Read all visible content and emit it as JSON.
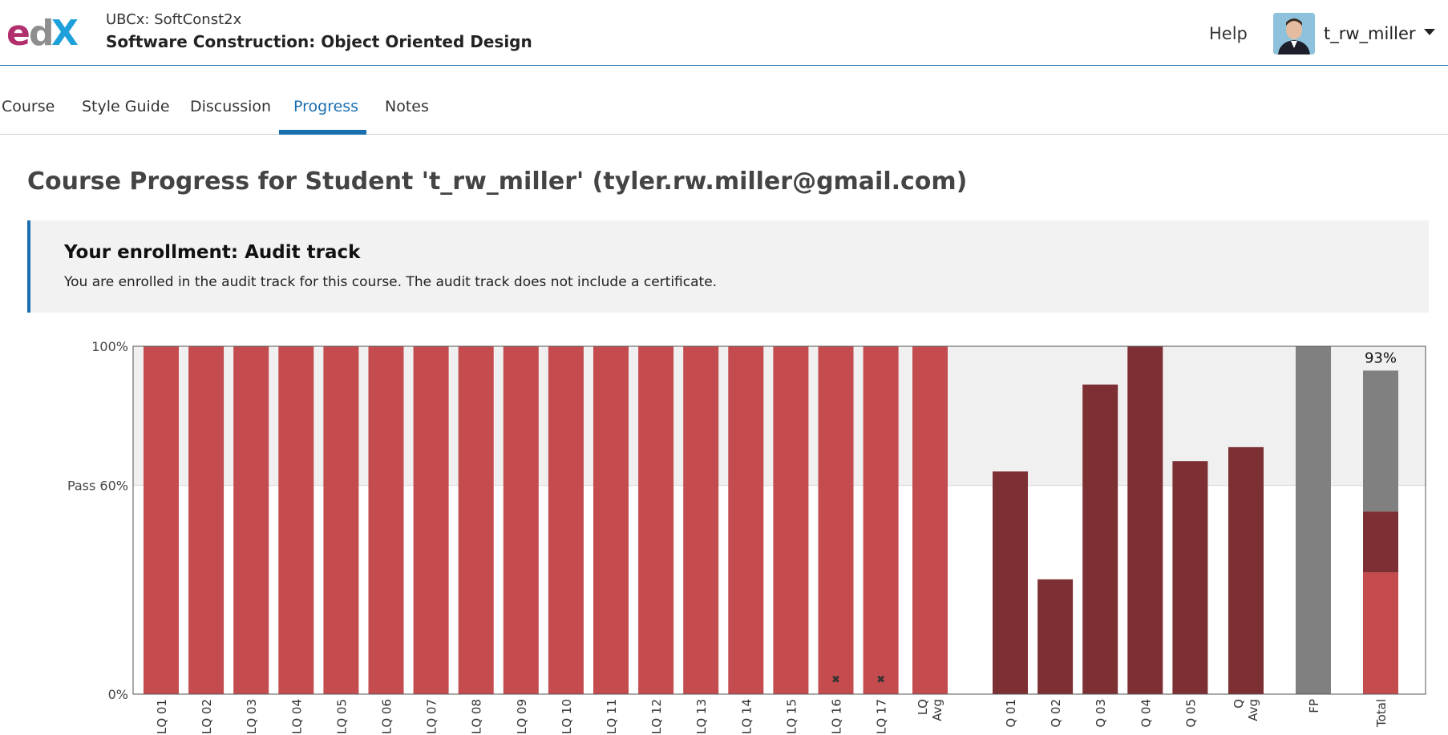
{
  "header": {
    "course_org": "UBCx: SoftConst2x",
    "course_title": "Software Construction: Object Oriented Design",
    "help_label": "Help",
    "username": "t_rw_miller"
  },
  "tabs": [
    {
      "label": "Course",
      "active": false
    },
    {
      "label": "Style Guide",
      "active": false
    },
    {
      "label": "Discussion",
      "active": false
    },
    {
      "label": "Progress",
      "active": true
    },
    {
      "label": "Notes",
      "active": false
    }
  ],
  "page": {
    "title": "Course Progress for Student 't_rw_miller' (tyler.rw.miller@gmail.com)"
  },
  "enrollment": {
    "heading": "Your enrollment: Audit track",
    "text": "You are enrolled in the audit track for this course. The audit track does not include a certificate."
  },
  "colors": {
    "accent": "#1a6fb0",
    "lq_bar": "#c44b4e",
    "quiz_bar": "#7d3034",
    "fp_bar": "#808080",
    "pass_band": "#f0f0f0"
  },
  "chart_data": {
    "type": "bar",
    "ylim": [
      0,
      100
    ],
    "y_ticks": [
      {
        "value": 100,
        "label": "100%"
      },
      {
        "value": 60,
        "label": "Pass 60%"
      },
      {
        "value": 0,
        "label": "0%"
      }
    ],
    "bars": [
      {
        "label": "LQ 01",
        "value": 100,
        "group": "lq"
      },
      {
        "label": "LQ 02",
        "value": 100,
        "group": "lq"
      },
      {
        "label": "LQ 03",
        "value": 100,
        "group": "lq"
      },
      {
        "label": "LQ 04",
        "value": 100,
        "group": "lq"
      },
      {
        "label": "LQ 05",
        "value": 100,
        "group": "lq"
      },
      {
        "label": "LQ 06",
        "value": 100,
        "group": "lq"
      },
      {
        "label": "LQ 07",
        "value": 100,
        "group": "lq"
      },
      {
        "label": "LQ 08",
        "value": 100,
        "group": "lq"
      },
      {
        "label": "LQ 09",
        "value": 100,
        "group": "lq"
      },
      {
        "label": "LQ 10",
        "value": 100,
        "group": "lq"
      },
      {
        "label": "LQ 11",
        "value": 100,
        "group": "lq"
      },
      {
        "label": "LQ 12",
        "value": 100,
        "group": "lq"
      },
      {
        "label": "LQ 13",
        "value": 100,
        "group": "lq"
      },
      {
        "label": "LQ 14",
        "value": 100,
        "group": "lq"
      },
      {
        "label": "LQ 15",
        "value": 100,
        "group": "lq"
      },
      {
        "label": "LQ 16",
        "value": 100,
        "group": "lq",
        "dropped": true
      },
      {
        "label": "LQ 17",
        "value": 100,
        "group": "lq",
        "dropped": true
      },
      {
        "label": "LQ Avg",
        "value": 100,
        "group": "lq",
        "summary": true
      },
      {
        "label": "Q 01",
        "value": 64,
        "group": "quiz"
      },
      {
        "label": "Q 02",
        "value": 33,
        "group": "quiz"
      },
      {
        "label": "Q 03",
        "value": 89,
        "group": "quiz"
      },
      {
        "label": "Q 04",
        "value": 100,
        "group": "quiz"
      },
      {
        "label": "Q 05",
        "value": 67,
        "group": "quiz"
      },
      {
        "label": "Q Avg",
        "value": 71,
        "group": "quiz",
        "summary": true
      },
      {
        "label": "FP",
        "value": 100,
        "group": "fp",
        "summary": true
      }
    ],
    "total": {
      "label": "Total",
      "value_label": "93%",
      "segments": [
        {
          "group": "lq",
          "value": 35
        },
        {
          "group": "quiz",
          "value": 17.5
        },
        {
          "group": "fp",
          "value": 40.5
        }
      ]
    },
    "dropped_marker": "✖"
  }
}
